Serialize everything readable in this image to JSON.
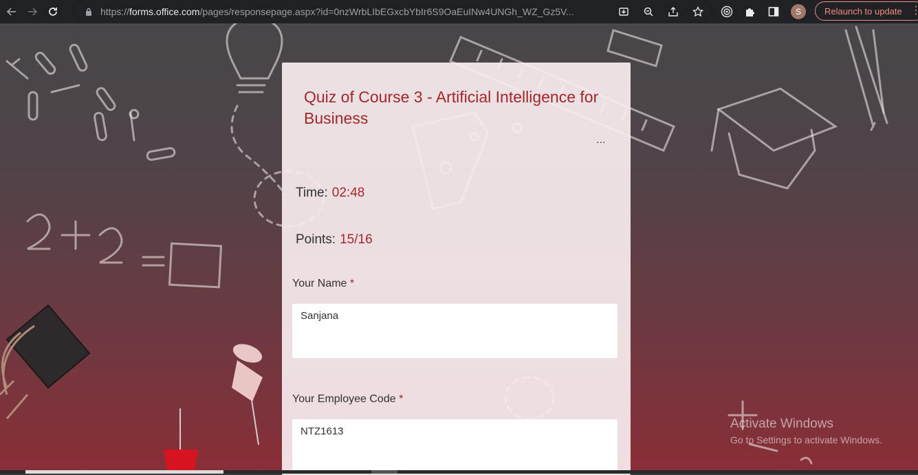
{
  "browser": {
    "url_scheme": "https://",
    "url_domain": "forms.office.com",
    "url_path": "/pages/responsepage.aspx?id=0nzWrbLIbEGxcbYbIr6S9OaEuINw4UNGh_WZ_Gz5V...",
    "profile_initial": "S",
    "relaunch_label": "Relaunch to update",
    "accent_color": "#f28b82"
  },
  "form": {
    "title": "Quiz of Course 3 -  Artificial Intelligence for Business",
    "more_label": "...",
    "time_label": "Time:",
    "time_value": "02:48",
    "points_label": "Points:",
    "points_value": "15/16",
    "questions": [
      {
        "label": "Your Name",
        "required_mark": "*",
        "answer": "Sanjana"
      },
      {
        "label": "Your Employee Code",
        "required_mark": "*",
        "answer": "NTZ1613"
      }
    ],
    "accent_color": "#a4262c"
  },
  "watermark": {
    "title": "Activate Windows",
    "subtitle": "Go to Settings to activate Windows."
  }
}
